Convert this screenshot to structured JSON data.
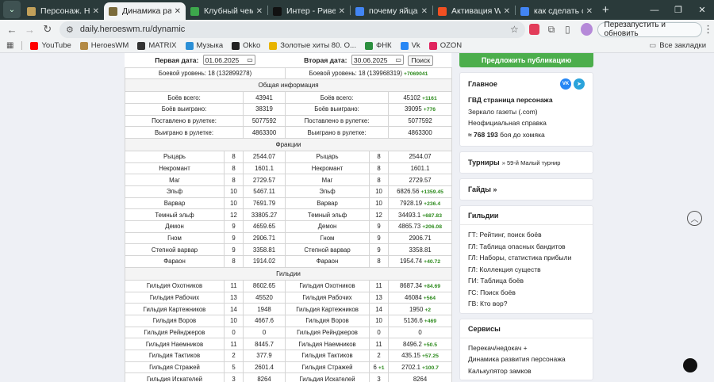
{
  "browser": {
    "tabs": [
      {
        "title": "Персонаж. HeroesWM",
        "color": "#c2a15a",
        "active": false
      },
      {
        "title": "Динамика развития",
        "color": "#7a6a3a",
        "active": true
      },
      {
        "title": "Клубный чемпионат",
        "color": "#3da84c",
        "active": false
      },
      {
        "title": "Интер - Ривер Плейт",
        "color": "#111111",
        "active": false
      },
      {
        "title": "почему яйца потеют",
        "color": "#4285f4",
        "active": false
      },
      {
        "title": "Активация Windows",
        "color": "#f25022",
        "active": false
      },
      {
        "title": "как сделать скрин",
        "color": "#4285f4",
        "active": false
      }
    ],
    "url": "daily.heroeswm.ru/dynamic",
    "restart_label": "Перезапустить и обновить",
    "bookmarks": [
      {
        "label": "YouTube",
        "color": "#ff0000"
      },
      {
        "label": "HeroesWM",
        "color": "#b38a45"
      },
      {
        "label": "MATRIX",
        "color": "#333333"
      },
      {
        "label": "Музыка",
        "color": "#2b8fd6"
      },
      {
        "label": "Okko",
        "color": "#222222"
      },
      {
        "label": "Золотые хиты 80. О...",
        "color": "#e8b400"
      },
      {
        "label": "ФНК",
        "color": "#2c8f3f"
      },
      {
        "label": "Vk",
        "color": "#2787f5"
      },
      {
        "label": "OZON",
        "color": "#e0245e"
      }
    ],
    "all_bookmarks": "Все закладки"
  },
  "dates": {
    "first_label": "Первая дата:",
    "first_value": "01.06.2025",
    "second_label": "Вторая дата:",
    "second_value": "30.06.2025",
    "search_label": "Поиск"
  },
  "level": {
    "left": "Боевой уровень: 18 (132899278)",
    "right": "Боевой уровень: 18 (139968319)",
    "right_delta": "+7069041"
  },
  "sections": {
    "general": "Общая информация",
    "factions": "Фракции",
    "guilds": "Гильдии"
  },
  "general": [
    {
      "label": "Боёв всего:",
      "l": "43941",
      "r": "45102",
      "d": "+1161"
    },
    {
      "label": "Боёв выиграно:",
      "l": "38319",
      "r": "39095",
      "d": "+776"
    },
    {
      "label": "Поставлено в рулетке:",
      "l": "5077592",
      "r": "5077592",
      "d": ""
    },
    {
      "label": "Выиграно в рулетке:",
      "l": "4863300",
      "r": "4863300",
      "d": ""
    }
  ],
  "factions": [
    {
      "name": "Рыцарь",
      "lv1": "8",
      "v1": "2544.07",
      "lv2": "8",
      "lv2d": "",
      "v2": "2544.07",
      "d": ""
    },
    {
      "name": "Некромант",
      "lv1": "8",
      "v1": "1601.1",
      "lv2": "8",
      "lv2d": "",
      "v2": "1601.1",
      "d": ""
    },
    {
      "name": "Маг",
      "lv1": "8",
      "v1": "2729.57",
      "lv2": "8",
      "lv2d": "",
      "v2": "2729.57",
      "d": ""
    },
    {
      "name": "Эльф",
      "lv1": "10",
      "v1": "5467.11",
      "lv2": "10",
      "lv2d": "",
      "v2": "6826.56",
      "d": "+1359.45"
    },
    {
      "name": "Варвар",
      "lv1": "10",
      "v1": "7691.79",
      "lv2": "10",
      "lv2d": "",
      "v2": "7928.19",
      "d": "+236.4"
    },
    {
      "name": "Темный эльф",
      "lv1": "12",
      "v1": "33805.27",
      "lv2": "12",
      "lv2d": "",
      "v2": "34493.1",
      "d": "+687.83"
    },
    {
      "name": "Демон",
      "lv1": "9",
      "v1": "4659.65",
      "lv2": "9",
      "lv2d": "",
      "v2": "4865.73",
      "d": "+206.08"
    },
    {
      "name": "Гном",
      "lv1": "9",
      "v1": "2906.71",
      "lv2": "9",
      "lv2d": "",
      "v2": "2906.71",
      "d": ""
    },
    {
      "name": "Степной варвар",
      "lv1": "9",
      "v1": "3358.81",
      "lv2": "9",
      "lv2d": "",
      "v2": "3358.81",
      "d": ""
    },
    {
      "name": "Фараон",
      "lv1": "8",
      "v1": "1914.02",
      "lv2": "8",
      "lv2d": "",
      "v2": "1954.74",
      "d": "+40.72"
    }
  ],
  "guilds": [
    {
      "name": "Гильдия Охотников",
      "lv1": "11",
      "v1": "8602.65",
      "lv2": "11",
      "lv2d": "",
      "v2": "8687.34",
      "d": "+84.69"
    },
    {
      "name": "Гильдия Рабочих",
      "lv1": "13",
      "v1": "45520",
      "lv2": "13",
      "lv2d": "",
      "v2": "46084",
      "d": "+564"
    },
    {
      "name": "Гильдия Картежников",
      "lv1": "14",
      "v1": "1948",
      "lv2": "14",
      "lv2d": "",
      "v2": "1950",
      "d": "+2"
    },
    {
      "name": "Гильдия Воров",
      "lv1": "10",
      "v1": "4667.6",
      "lv2": "10",
      "lv2d": "",
      "v2": "5136.6",
      "d": "+469"
    },
    {
      "name": "Гильдия Рейнджеров",
      "lv1": "0",
      "v1": "0",
      "lv2": "0",
      "lv2d": "",
      "v2": "0",
      "d": ""
    },
    {
      "name": "Гильдия Наемников",
      "lv1": "11",
      "v1": "8445.7",
      "lv2": "11",
      "lv2d": "",
      "v2": "8496.2",
      "d": "+50.5"
    },
    {
      "name": "Гильдия Тактиков",
      "lv1": "2",
      "v1": "377.9",
      "lv2": "2",
      "lv2d": "",
      "v2": "435.15",
      "d": "+57.25"
    },
    {
      "name": "Гильдия Стражей",
      "lv1": "5",
      "v1": "2601.4",
      "lv2": "6",
      "lv2d": "+1",
      "v2": "2702.1",
      "d": "+100.7"
    },
    {
      "name": "Гильдия Искателей",
      "lv1": "3",
      "v1": "8264",
      "lv2": "3",
      "lv2d": "",
      "v2": "8264",
      "d": ""
    }
  ],
  "sidebar": {
    "publish": "Предложить публикацию",
    "main_title": "Главное",
    "vk": "VK",
    "main_links": [
      {
        "bold": "ГВД страница персонажа",
        "text": ""
      },
      {
        "bold": "",
        "text": "Зеркало газеты (.com)"
      },
      {
        "bold": "",
        "text": "Неофициальная справка"
      },
      {
        "bold": "≈ 768 193",
        "text": " боя до хомяка"
      }
    ],
    "tournaments_title": "Турниры",
    "tournaments_sub": "» 59-й Малый турнир",
    "guides_title": "Гайды »",
    "guilds_title": "Гильдии",
    "guild_links": [
      "ГТ: Рейтинг, поиск боёв",
      "ГЛ: Таблица опасных бандитов",
      "ГЛ: Наборы, статистика прибыли",
      "ГЛ: Коллекция существ",
      "ГИ: Таблица боёв",
      "ГС: Поиск боёв",
      "ГВ: Кто вор?"
    ],
    "services_title": "Сервисы",
    "service_links": [
      "Перекач/недокач +",
      "Динамика развития персонажа",
      "Калькулятор замков"
    ]
  }
}
